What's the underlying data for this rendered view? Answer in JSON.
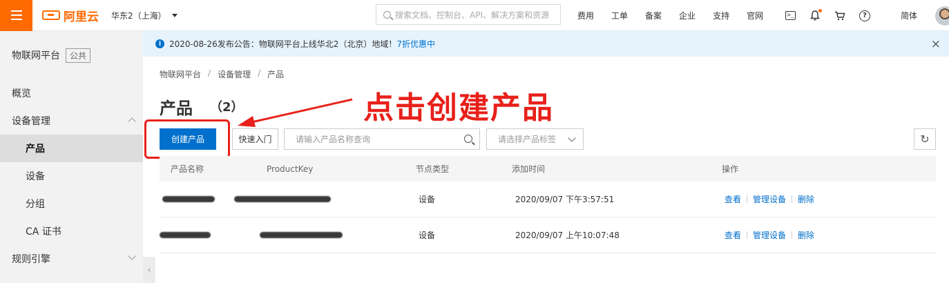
{
  "topbar": {
    "logo_text": "阿里云",
    "region": "华东2（上海）",
    "search_placeholder": "搜索文档、控制台、API、解决方案和资源",
    "nav_links": [
      "费用",
      "工单",
      "备案",
      "企业",
      "支持",
      "官网"
    ],
    "terminal_glyph": ">_",
    "help_glyph": "?",
    "language": "简体",
    "icons": [
      "hamburger-icon",
      "terminal-icon",
      "bell-icon",
      "cart-icon",
      "help-icon",
      "avatar"
    ],
    "accent_color": "#ff6a00"
  },
  "sidebar": {
    "title": "物联网平台",
    "tag": "公共",
    "items": [
      {
        "label": "概览"
      },
      {
        "label": "设备管理"
      },
      {
        "label": "产品"
      },
      {
        "label": "设备"
      },
      {
        "label": "分组"
      },
      {
        "label": "CA 证书"
      },
      {
        "label": "规则引擎"
      }
    ]
  },
  "notice": {
    "text": "2020-08-26发布公告：物联网平台上线华北2（北京）地域！",
    "link": "7折优惠中",
    "close_glyph": "×"
  },
  "breadcrumb": [
    "物联网平台",
    "设备管理",
    "产品"
  ],
  "page": {
    "title": "产品",
    "count": "（2）"
  },
  "annotation": {
    "text": "点击创建产品",
    "color": "#e8201a"
  },
  "toolbar": {
    "create_label": "创建产品",
    "quickstart_label": "快速入门",
    "search_placeholder": "请输入产品名称查询",
    "tag_select_placeholder": "请选择产品标签",
    "refresh_glyph": "↻",
    "primary_color": "#0070cc"
  },
  "table": {
    "headers": [
      "产品名称",
      "ProductKey",
      "节点类型",
      "添加时间",
      "操作"
    ],
    "rows": [
      {
        "node_type": "设备",
        "created": "2020/09/07 下午3:57:51",
        "actions": [
          "查看",
          "管理设备",
          "删除"
        ]
      },
      {
        "node_type": "设备",
        "created": "2020/09/07 上午10:07:48",
        "actions": [
          "查看",
          "管理设备",
          "删除"
        ]
      }
    ]
  }
}
